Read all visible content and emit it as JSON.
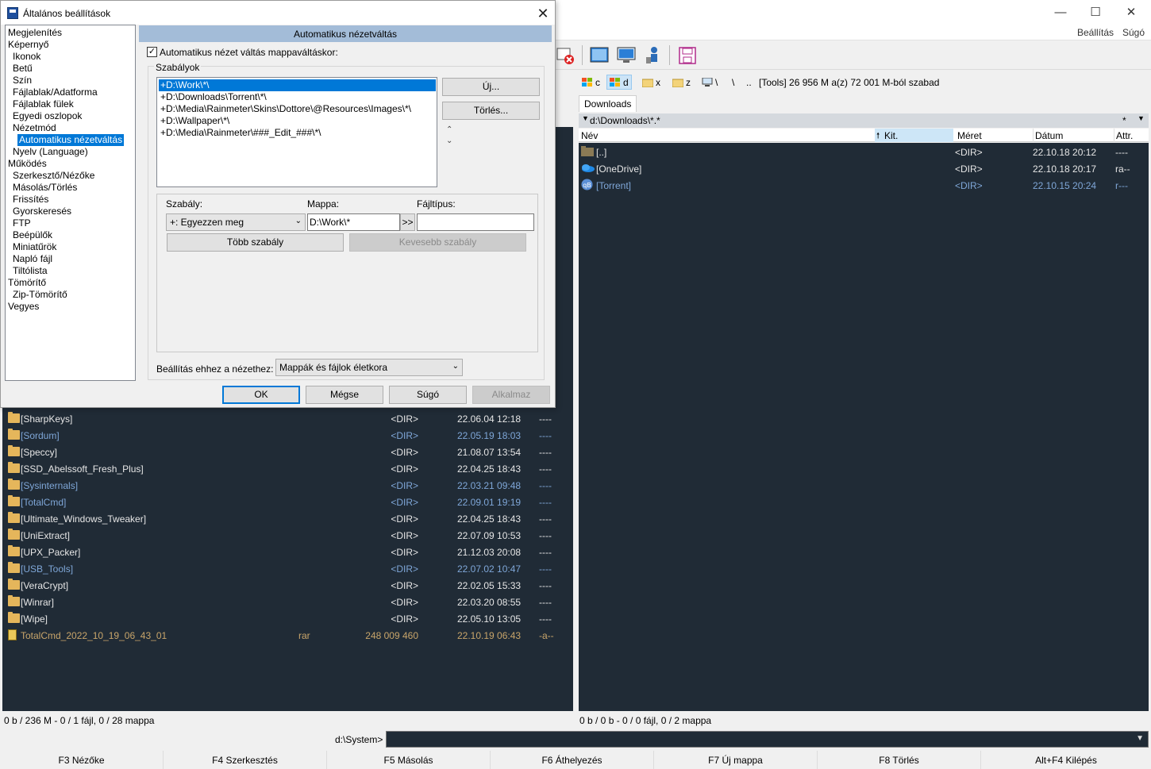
{
  "main_window": {
    "menu": [
      "Beállítás",
      "Súgó"
    ],
    "controls": [
      "—",
      "☐",
      "✕"
    ]
  },
  "drives": {
    "items": [
      {
        "label": "c",
        "active": false
      },
      {
        "label": "d",
        "active": true
      },
      {
        "label": "x",
        "active": false
      },
      {
        "label": "z",
        "active": false
      },
      {
        "label": "\\",
        "active": false
      }
    ],
    "nav": [
      "\\",
      ".."
    ],
    "info": "[Tools]  26 956 M a(z) 72 001 M-ból szabad"
  },
  "left_panel": {
    "rows": [
      {
        "name": "[SharpKeys]",
        "ext": "",
        "size": "<DIR>",
        "date": "22.06.04 12:18",
        "attr": "----",
        "style": "normal"
      },
      {
        "name": "[Sordum]",
        "ext": "",
        "size": "<DIR>",
        "date": "22.05.19 18:03",
        "attr": "----",
        "style": "dim"
      },
      {
        "name": "[Speccy]",
        "ext": "",
        "size": "<DIR>",
        "date": "21.08.07 13:54",
        "attr": "----",
        "style": "normal"
      },
      {
        "name": "[SSD_Abelssoft_Fresh_Plus]",
        "ext": "",
        "size": "<DIR>",
        "date": "22.04.25 18:43",
        "attr": "----",
        "style": "normal"
      },
      {
        "name": "[Sysinternals]",
        "ext": "",
        "size": "<DIR>",
        "date": "22.03.21 09:48",
        "attr": "----",
        "style": "dim"
      },
      {
        "name": "[TotalCmd]",
        "ext": "",
        "size": "<DIR>",
        "date": "22.09.01 19:19",
        "attr": "----",
        "style": "dim"
      },
      {
        "name": "[Ultimate_Windows_Tweaker]",
        "ext": "",
        "size": "<DIR>",
        "date": "22.04.25 18:43",
        "attr": "----",
        "style": "normal"
      },
      {
        "name": "[UniExtract]",
        "ext": "",
        "size": "<DIR>",
        "date": "22.07.09 10:53",
        "attr": "----",
        "style": "normal"
      },
      {
        "name": "[UPX_Packer]",
        "ext": "",
        "size": "<DIR>",
        "date": "21.12.03 20:08",
        "attr": "----",
        "style": "normal"
      },
      {
        "name": "[USB_Tools]",
        "ext": "",
        "size": "<DIR>",
        "date": "22.07.02 10:47",
        "attr": "----",
        "style": "dim"
      },
      {
        "name": "[VeraCrypt]",
        "ext": "",
        "size": "<DIR>",
        "date": "22.02.05 15:33",
        "attr": "----",
        "style": "normal"
      },
      {
        "name": "[Winrar]",
        "ext": "",
        "size": "<DIR>",
        "date": "22.03.20 08:55",
        "attr": "----",
        "style": "normal"
      },
      {
        "name": "[Wipe]",
        "ext": "",
        "size": "<DIR>",
        "date": "22.05.10 13:05",
        "attr": "----",
        "style": "normal"
      },
      {
        "name": "TotalCmd_2022_10_19_06_43_01",
        "ext": "rar",
        "size": "248 009 460",
        "date": "22.10.19 06:43",
        "attr": "-a--",
        "style": "arch"
      }
    ],
    "status": "0 b / 236 M - 0 / 1 fájl, 0 / 28 mappa"
  },
  "right_panel": {
    "tab": "Downloads",
    "path": "d:\\Downloads\\*.*",
    "path_filter": "*",
    "columns": {
      "name": "Név",
      "ext": "Kit.",
      "size": "Méret",
      "date": "Dátum",
      "attr": "Attr."
    },
    "rows": [
      {
        "name": "[..]",
        "size": "<DIR>",
        "date": "22.10.18 20:12",
        "attr": "----",
        "icon": "folder-up",
        "style": "normal"
      },
      {
        "name": "[OneDrive]",
        "size": "<DIR>",
        "date": "22.10.18 20:17",
        "attr": "ra--",
        "icon": "onedrive",
        "style": "normal"
      },
      {
        "name": "[Torrent]",
        "size": "<DIR>",
        "date": "22.10.15 20:24",
        "attr": "r---",
        "icon": "torrent",
        "style": "dim"
      }
    ],
    "status": "0 b / 0 b - 0 / 0 fájl, 0 / 2 mappa"
  },
  "command": {
    "label": "d:\\System>",
    "value": ""
  },
  "fkeys": [
    "F3 Nézőke",
    "F4 Szerkesztés",
    "F5 Másolás",
    "F6 Áthelyezés",
    "F7 Új mappa",
    "F8 Törlés",
    "Alt+F4 Kilépés"
  ],
  "dialog": {
    "title": "Általános beállítások",
    "tree": [
      {
        "label": "Megjelenítés",
        "level": 0
      },
      {
        "label": "Képernyő",
        "level": 0
      },
      {
        "label": "Ikonok",
        "level": 1
      },
      {
        "label": "Betű",
        "level": 1
      },
      {
        "label": "Szín",
        "level": 1
      },
      {
        "label": "Fájlablak/Adatforma",
        "level": 1
      },
      {
        "label": "Fájlablak fülek",
        "level": 1
      },
      {
        "label": "Egyedi oszlopok",
        "level": 1
      },
      {
        "label": "Nézetmód",
        "level": 1
      },
      {
        "label": "Automatikus nézetváltás",
        "level": 2,
        "selected": true
      },
      {
        "label": "Nyelv (Language)",
        "level": 1
      },
      {
        "label": "Működés",
        "level": 0
      },
      {
        "label": "Szerkesztő/Nézőke",
        "level": 1
      },
      {
        "label": "Másolás/Törlés",
        "level": 1
      },
      {
        "label": "Frissítés",
        "level": 1
      },
      {
        "label": "Gyorskeresés",
        "level": 1
      },
      {
        "label": "FTP",
        "level": 1
      },
      {
        "label": "Beépülők",
        "level": 1
      },
      {
        "label": "Miniatűrök",
        "level": 1
      },
      {
        "label": "Napló fájl",
        "level": 1
      },
      {
        "label": "Tiltólista",
        "level": 1
      },
      {
        "label": "Tömörítő",
        "level": 0
      },
      {
        "label": "Zip-Tömörítő",
        "level": 1
      },
      {
        "label": "Vegyes",
        "level": 0
      }
    ],
    "section_header": "Automatikus nézetváltás",
    "auto_checkbox_label": "Automatikus nézet váltás mappaváltáskor:",
    "auto_checked": true,
    "rules_group_label": "Szabályok",
    "rules": [
      "+D:\\Work\\*\\",
      "+D:\\Downloads\\Torrent\\*\\",
      "+D:\\Media\\Rainmeter\\Skins\\Dottore\\@Resources\\Images\\*\\",
      "+D:\\Wallpaper\\*\\",
      "+D:\\Media\\Rainmeter\\###_Edit_###\\*\\"
    ],
    "new_button": "Új...",
    "delete_button": "Törlés...",
    "rule_label": "Szabály:",
    "folder_label": "Mappa:",
    "filetype_label": "Fájltípus:",
    "rule_value": "+: Egyezzen meg",
    "folder_value": "D:\\Work\\*",
    "browse_button": ">>",
    "filetype_value": "",
    "more_rules_button": "Több szabály",
    "fewer_rules_button": "Kevesebb szabály",
    "setting_label": "Beállítás ehhez a nézethez:",
    "setting_value": "Mappák és fájlok életkora",
    "ok_button": "OK",
    "cancel_button": "Mégse",
    "help_button": "Súgó",
    "apply_button": "Alkalmaz"
  }
}
